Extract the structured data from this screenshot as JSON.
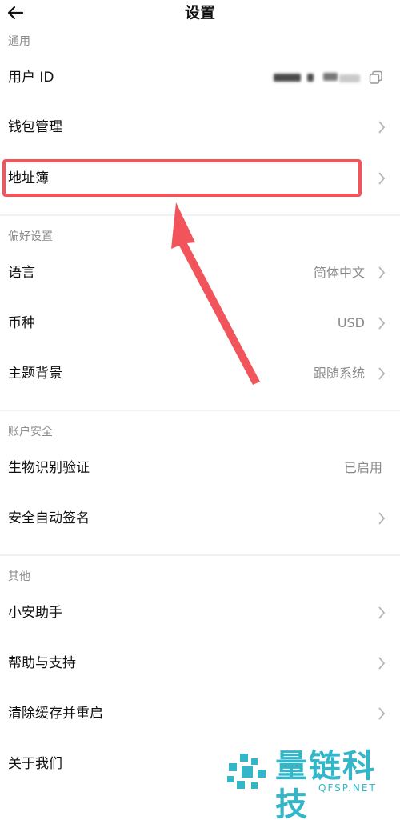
{
  "header": {
    "title": "设置",
    "back_icon": "arrow-left-icon"
  },
  "sections": {
    "general": {
      "title": "通用",
      "user_id": {
        "label": "用户 ID",
        "copy_icon": "copy-icon"
      },
      "wallet": {
        "label": "钱包管理"
      },
      "address_book": {
        "label": "地址簿"
      }
    },
    "preferences": {
      "title": "偏好设置",
      "language": {
        "label": "语言",
        "value": "简体中文"
      },
      "currency": {
        "label": "币种",
        "value": "USD"
      },
      "theme": {
        "label": "主题背景",
        "value": "跟随系统"
      }
    },
    "security": {
      "title": "账户安全",
      "biometric": {
        "label": "生物识别验证",
        "value": "已启用"
      },
      "auto_sign": {
        "label": "安全自动签名"
      }
    },
    "other": {
      "title": "其他",
      "assistant": {
        "label": "小安助手"
      },
      "help": {
        "label": "帮助与支持"
      },
      "clear_cache": {
        "label": "清除缓存并重启"
      },
      "about": {
        "label": "关于我们"
      }
    }
  },
  "annotation": {
    "color": "#f2545b"
  },
  "watermark": {
    "text": "量链科技",
    "subtext": "QFSP.NET",
    "color": "#34b6c9"
  }
}
